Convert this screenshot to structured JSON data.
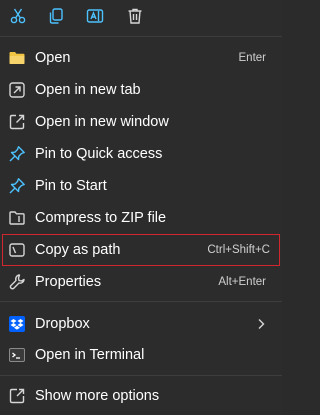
{
  "quick_actions": [
    {
      "icon": "cut-icon"
    },
    {
      "icon": "copy-icon"
    },
    {
      "icon": "rename-icon"
    },
    {
      "icon": "delete-icon"
    }
  ],
  "items": [
    {
      "label": "Open",
      "shortcut": "Enter",
      "icon": "folder-icon"
    },
    {
      "label": "Open in new tab",
      "shortcut": "",
      "icon": "open-new-tab-icon"
    },
    {
      "label": "Open in new window",
      "shortcut": "",
      "icon": "open-new-window-icon"
    },
    {
      "label": "Pin to Quick access",
      "shortcut": "",
      "icon": "pin-icon"
    },
    {
      "label": "Pin to Start",
      "shortcut": "",
      "icon": "pin-start-icon"
    },
    {
      "label": "Compress to ZIP file",
      "shortcut": "",
      "icon": "zip-icon"
    },
    {
      "label": "Copy as path",
      "shortcut": "Ctrl+Shift+C",
      "icon": "copy-path-icon",
      "highlighted": true
    },
    {
      "label": "Properties",
      "shortcut": "Alt+Enter",
      "icon": "wrench-icon"
    },
    {
      "label": "Dropbox",
      "shortcut": "",
      "icon": "dropbox-icon",
      "submenu": true
    },
    {
      "label": "Open in Terminal",
      "shortcut": "",
      "icon": "terminal-icon"
    },
    {
      "label": "Show more options",
      "shortcut": "",
      "icon": "show-more-icon"
    }
  ],
  "colors": {
    "background": "#2c2c2c",
    "icon_blue": "#4cc2ff",
    "folder_yellow": "#f0c544",
    "highlight_border": "#d0262d",
    "dropbox_blue": "#0061fe"
  }
}
